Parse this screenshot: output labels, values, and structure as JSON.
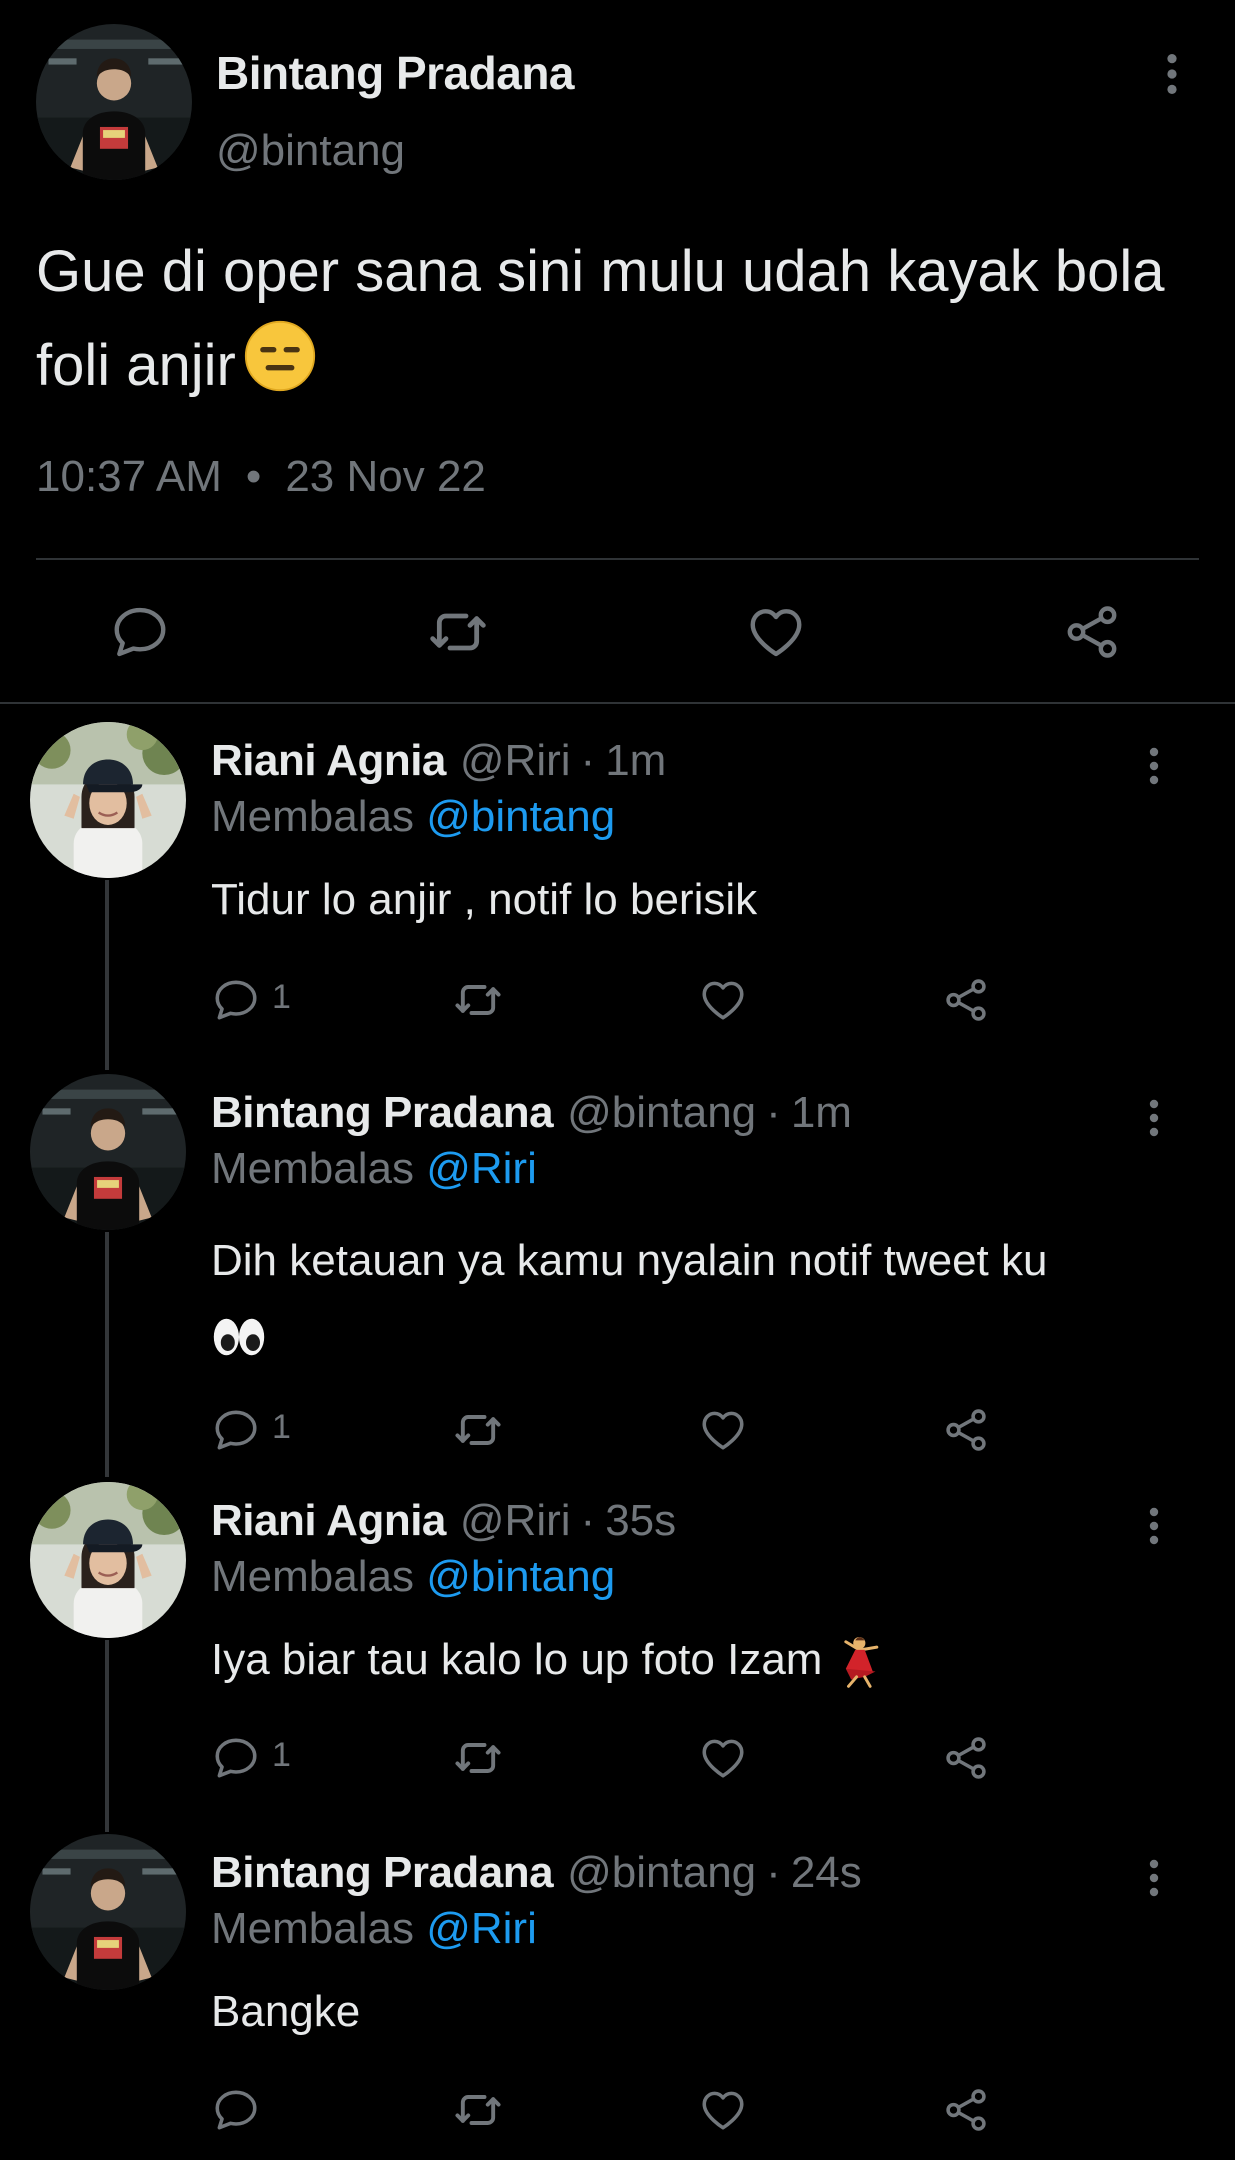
{
  "main_tweet": {
    "author_name": "Bintang Pradana",
    "author_handle": "@bintang",
    "text": "Gue di oper sana sini mulu udah kayak bola foli anjir",
    "time": "10:37 AM",
    "separator": "•",
    "date": "23 Nov 22",
    "emoji": "expressionless-face-emoji",
    "actions": [
      "reply-icon",
      "retweet-icon",
      "like-icon",
      "share-icon"
    ]
  },
  "replies": [
    {
      "author_name": "Riani Agnia",
      "author_handle": "@Riri",
      "separator": "·",
      "time": "1m",
      "replying_prefix": "Membalas",
      "replying_to": "@bintang",
      "text": "Tidur lo anjir , notif lo berisik",
      "reply_count": "1"
    },
    {
      "author_name": "Bintang Pradana",
      "author_handle": "@bintang",
      "separator": "·",
      "time": "1m",
      "replying_prefix": "Membalas",
      "replying_to": "@Riri",
      "text": "Dih ketauan ya kamu nyalain notif tweet ku",
      "emoji": "eyes-emoji",
      "reply_count": "1"
    },
    {
      "author_name": "Riani Agnia",
      "author_handle": "@Riri",
      "separator": "·",
      "time": "35s",
      "replying_prefix": "Membalas",
      "replying_to": "@bintang",
      "text": "Iya biar tau kalo lo up foto Izam",
      "emoji": "dancer-emoji",
      "reply_count": "1"
    },
    {
      "author_name": "Bintang Pradana",
      "author_handle": "@bintang",
      "separator": "·",
      "time": "24s",
      "replying_prefix": "Membalas",
      "replying_to": "@Riri",
      "text": "Bangke",
      "reply_count": ""
    }
  ],
  "colors": {
    "background": "#000000",
    "text_primary": "#e7e9ea",
    "text_secondary": "#71767b",
    "accent": "#1d9bf0",
    "divider": "#2f3336"
  }
}
